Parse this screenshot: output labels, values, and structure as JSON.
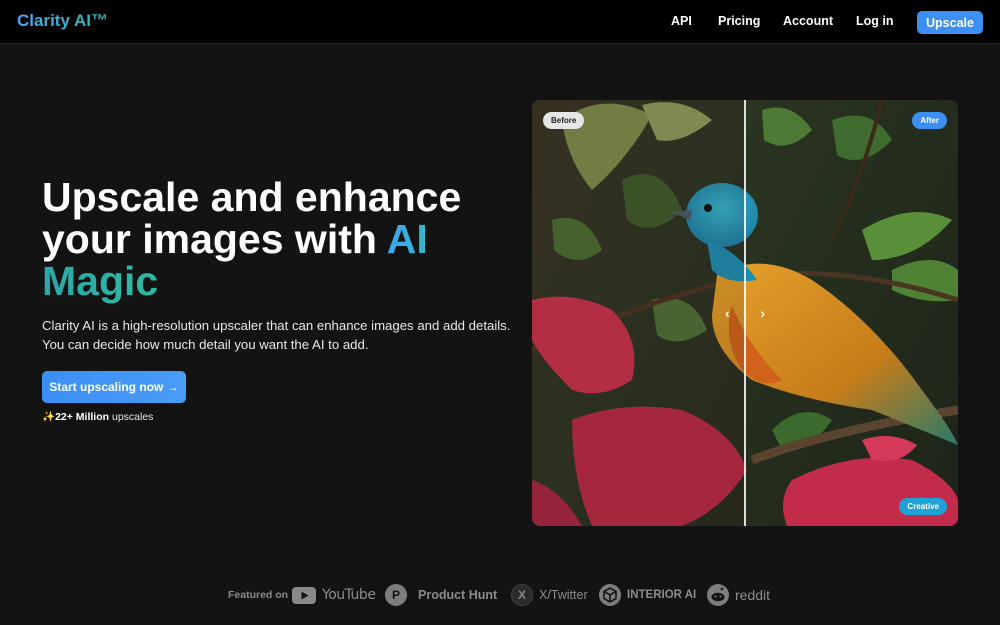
{
  "header": {
    "logo": "Clarity AI™",
    "nav": [
      "API",
      "Pricing",
      "Account",
      "Log in"
    ],
    "upscale_button": "Upscale"
  },
  "hero": {
    "title_line1": "Upscale and enhance",
    "title_line2_prefix": "your images with ",
    "title_line2_accent": "AI",
    "title_line3_accent": "Magic",
    "description": "Clarity AI is a high-resolution upscaler that can enhance images and add details. You can decide how much detail you want the AI to add.",
    "cta_label": "Start upscaling now →",
    "stats_emoji": "✨",
    "stats_bold": "22+ Million",
    "stats_rest": " upscales"
  },
  "compare": {
    "before_label": "Before",
    "after_label": "After",
    "mode_label": "Creative",
    "slider_position": 0.5,
    "handle_left": "‹",
    "handle_right": "›"
  },
  "featured": {
    "label": "Featured on",
    "brands": [
      {
        "name": "YouTube",
        "icon": "youtube-icon"
      },
      {
        "name": "Product Hunt",
        "icon": "product-hunt-icon",
        "glyph": "P"
      },
      {
        "name": "X/Twitter",
        "icon": "x-twitter-icon",
        "glyph": "X"
      },
      {
        "name": "INTERIOR AI",
        "icon": "interior-ai-icon"
      },
      {
        "name": "reddit",
        "icon": "reddit-icon"
      }
    ]
  },
  "colors": {
    "background": "#131313",
    "accent_blue": "#3b8ff5",
    "accent_teal": "#2fb7b0"
  }
}
